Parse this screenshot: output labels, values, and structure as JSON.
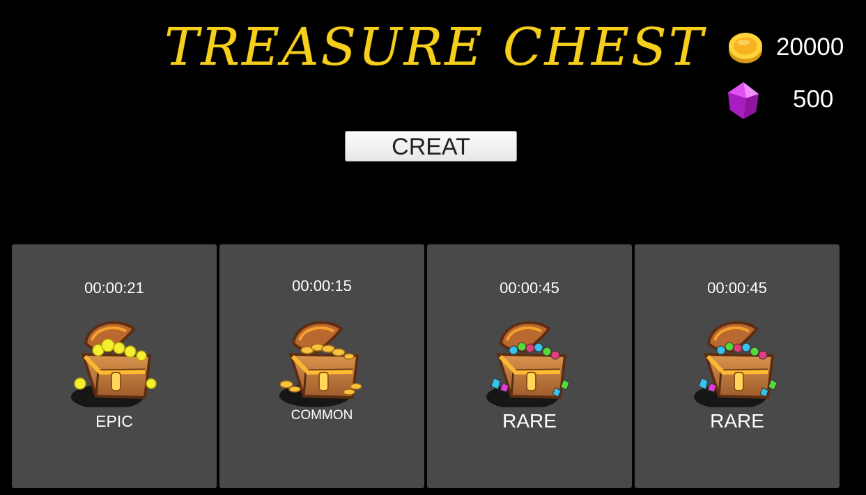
{
  "header": {
    "title": "TREASURE CHEST"
  },
  "currency": {
    "coins": {
      "icon": "gold-coin-icon",
      "value": "20000"
    },
    "gems": {
      "icon": "purple-gem-icon",
      "value": "500"
    }
  },
  "actions": {
    "create_label": "CREAT"
  },
  "chests": [
    {
      "timer": "00:00:21",
      "rarity": "EPIC",
      "icon": "epic-chest-icon"
    },
    {
      "timer": "00:00:15",
      "rarity": "COMMON",
      "icon": "common-chest-icon"
    },
    {
      "timer": "00:00:45",
      "rarity": "RARE",
      "icon": "rare-chest-icon"
    },
    {
      "timer": "00:00:45",
      "rarity": "RARE",
      "icon": "rare-chest-icon"
    }
  ],
  "colors": {
    "background": "#000000",
    "title": "#f5cf1c",
    "card": "#494949",
    "text": "#ffffff",
    "button": "#f4f4f4"
  }
}
